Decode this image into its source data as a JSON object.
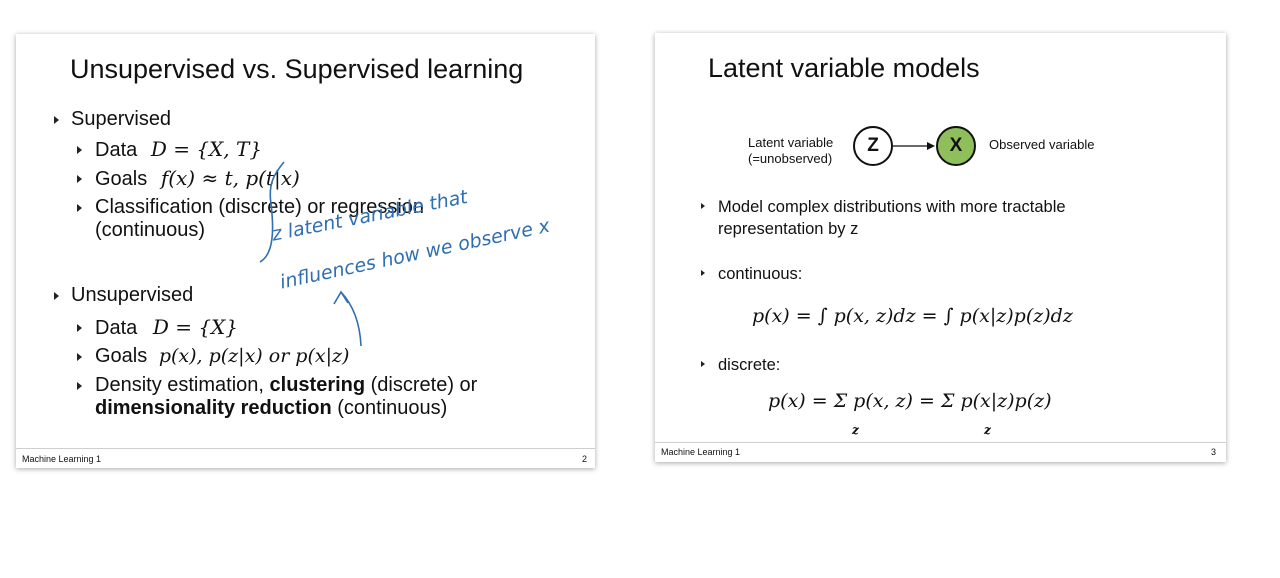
{
  "slide_left": {
    "title": "Unsupervised vs. Supervised learning",
    "supervised": {
      "heading": "Supervised",
      "data_label": "Data",
      "data_math": "D = {X, T}",
      "goals_label": "Goals",
      "goals_math": "f(x) ≈ t, p(t|x)",
      "task_line1": "Classification (discrete) or regression",
      "task_line2": "(continuous)"
    },
    "unsupervised": {
      "heading": "Unsupervised",
      "data_label": "Data",
      "data_math": "D = {X}",
      "goals_label": "Goals",
      "goals_math": "p(x), p(z|x) or p(x|z)",
      "task_line1_a": "Density estimation, ",
      "task_line1_b": "clustering",
      "task_line1_c": " (discrete) or",
      "task_line2_a": "dimensionality reduction",
      "task_line2_b": " (continuous)"
    },
    "handwriting": {
      "line1": "z latent variable that",
      "line2": "influences how we observe x"
    },
    "footer_left": "Machine Learning 1",
    "footer_right": "2"
  },
  "slide_right": {
    "title": "Latent variable models",
    "diagram": {
      "latent_label_line1": "Latent variable",
      "latent_label_line2": "(=unobserved)",
      "latent_node": "Z",
      "observed_node": "X",
      "observed_label": "Observed variable",
      "observed_color": "#8fbf5a"
    },
    "bullet1": "Model complex distributions with more tractable representation by z",
    "bullet2": "continuous:",
    "eq_continuous": "p(x) = ∫ p(x, z)dz = ∫ p(x|z)p(z)dz",
    "bullet3": "discrete:",
    "eq_discrete": "p(x) = Σ p(x, z) = Σ p(x|z)p(z)",
    "sum_index": "z",
    "footer_left": "Machine Learning 1",
    "footer_right": "3"
  }
}
